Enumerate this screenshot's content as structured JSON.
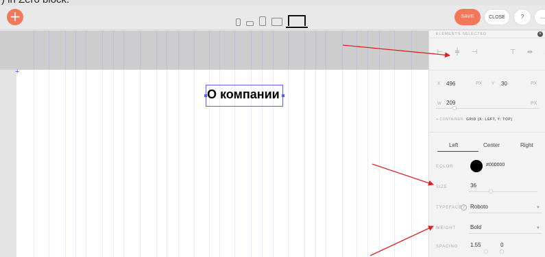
{
  "top_fragment": ") in Zero block.",
  "toolbar": {
    "add_label": "+",
    "save_label": "SAVE",
    "close_label": "CLOSE",
    "btn3_label": "?",
    "btn4_label": "..."
  },
  "canvas": {
    "headline": "О компании"
  },
  "panel": {
    "title": "ELEMENTS SELECTED",
    "close_label": "×",
    "x_label": "X",
    "x_value": "496",
    "x_unit": "PX",
    "y_label": "Y",
    "y_value": "30",
    "y_unit": "PX",
    "w_label": "W",
    "w_value": "209",
    "w_unit": "PX",
    "container_label": "+ CONTAINER:",
    "container_value": "GRID (X: LEFT, Y: TOP)",
    "align_tabs": [
      "Left",
      "Center",
      "Right"
    ],
    "color_label": "COLOR",
    "color_value": "#000000",
    "size_label": "SIZE",
    "size_value": "36",
    "typeface_label": "TYPEFACE",
    "typeface_value": "Roboto",
    "weight_label": "WEIGHT",
    "weight_value": "Bold",
    "spacing_label": "SPACING",
    "spacing_value": "1.55",
    "spacing_value2": "0"
  }
}
